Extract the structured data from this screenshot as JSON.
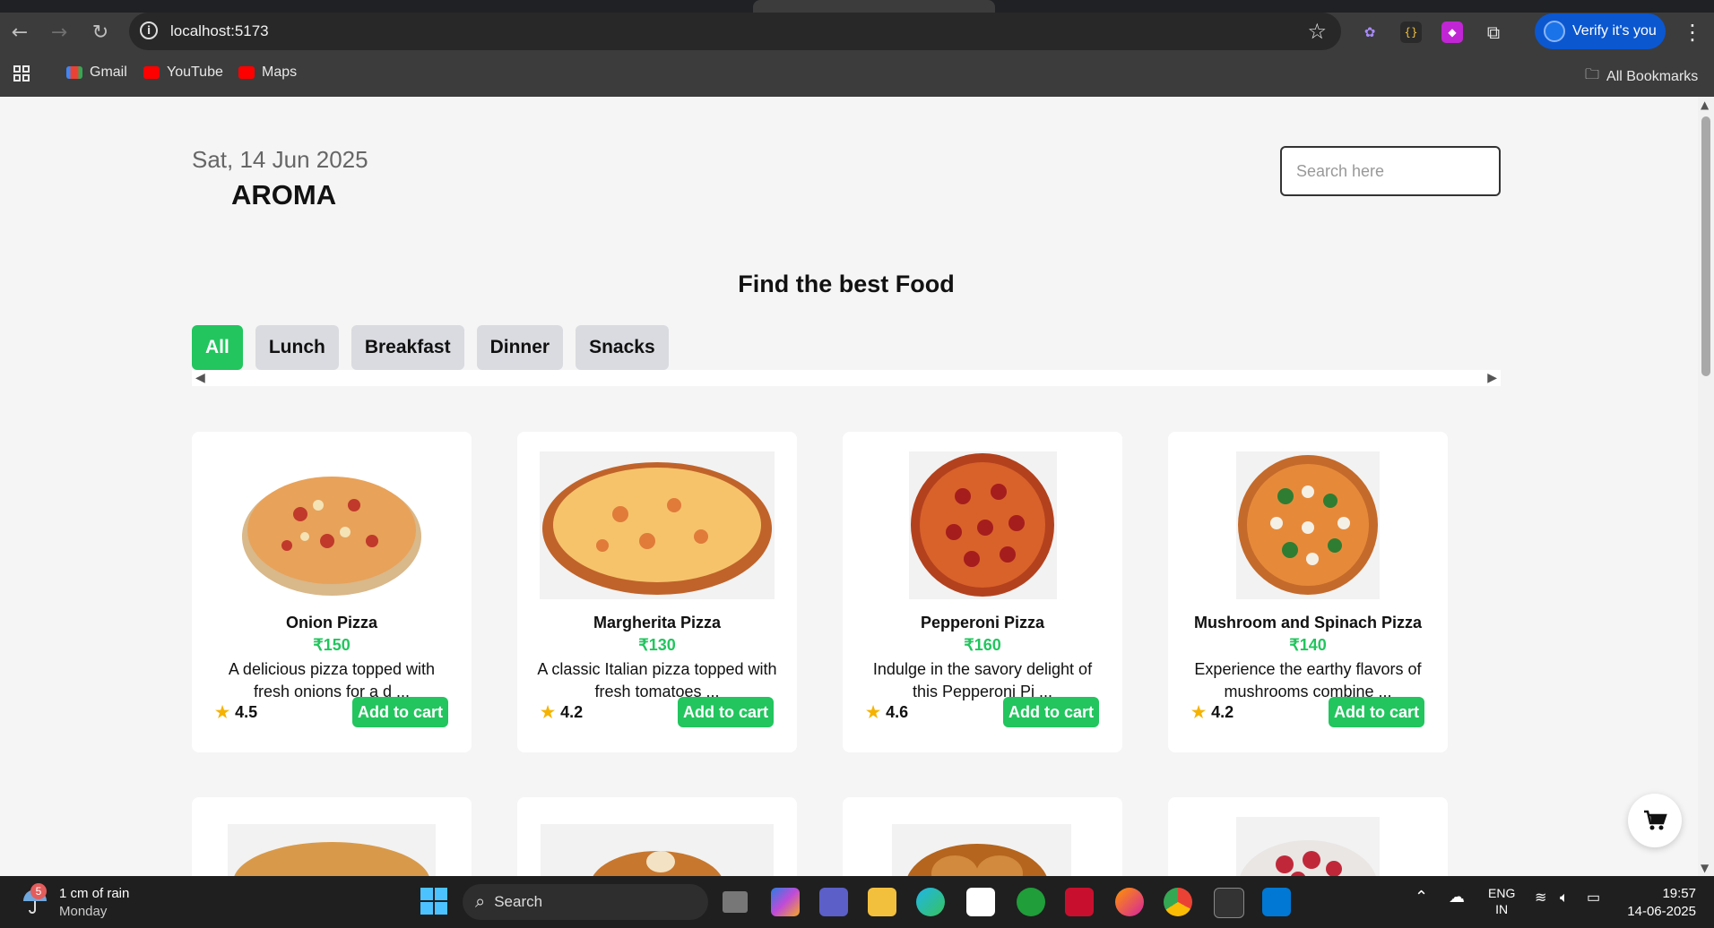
{
  "browser": {
    "url": "localhost:5173",
    "profile_label": "Verify it's you",
    "bookmarks": [
      "Gmail",
      "YouTube",
      "Maps"
    ],
    "all_bookmarks_label": "All Bookmarks"
  },
  "page": {
    "date": "Sat, 14 Jun 2025",
    "brand": "AROMA",
    "search_placeholder": "Search here",
    "heading": "Find the best Food",
    "categories": [
      "All",
      "Lunch",
      "Breakfast",
      "Dinner",
      "Snacks"
    ],
    "active_category": "All",
    "items": [
      {
        "name": "Onion Pizza",
        "price": "₹150",
        "desc": "A delicious pizza topped with fresh onions for a d ...",
        "rating": "4.5"
      },
      {
        "name": "Margherita Pizza",
        "price": "₹130",
        "desc": "A classic Italian pizza topped with fresh tomatoes ...",
        "rating": "4.2"
      },
      {
        "name": "Pepperoni Pizza",
        "price": "₹160",
        "desc": "Indulge in the savory delight of this Pepperoni Pi ...",
        "rating": "4.6"
      },
      {
        "name": "Mushroom and Spinach Pizza",
        "price": "₹140",
        "desc": "Experience the earthy flavors of mushrooms combine ...",
        "rating": "4.2"
      }
    ],
    "add_to_cart_label": "Add to cart"
  },
  "taskbar": {
    "weather_badge": "5",
    "weather_line1": "1 cm of rain",
    "weather_line2": "Monday",
    "search_label": "Search",
    "lang_line1": "ENG",
    "lang_line2": "IN",
    "time": "19:57",
    "date": "14-06-2025"
  },
  "colors": {
    "accent": "#22c55e",
    "chrome_bg": "#3c3c3c",
    "taskbar_bg": "#1f1f1f"
  }
}
